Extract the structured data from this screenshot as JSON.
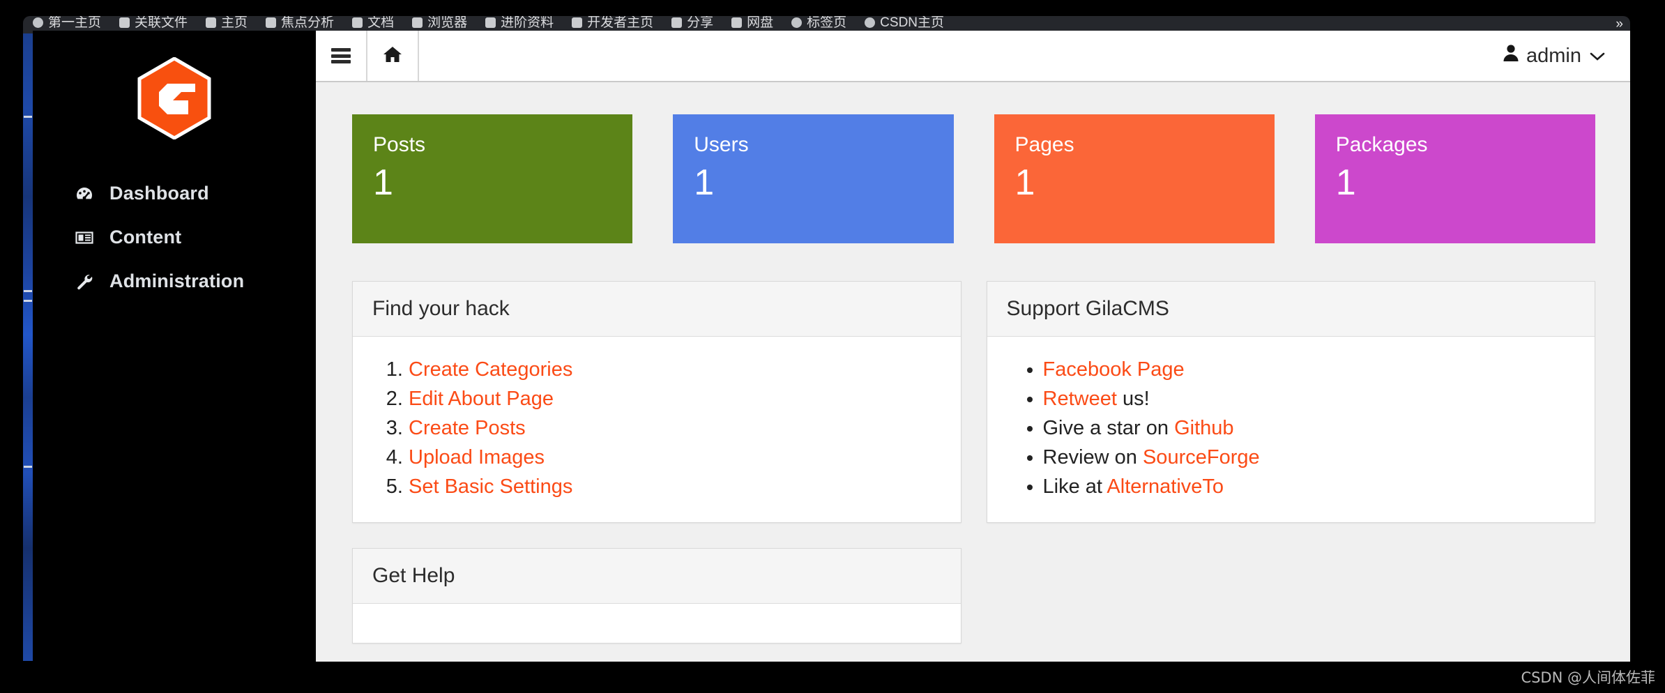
{
  "browser": {
    "bookmarks": [
      {
        "label": "第一主页",
        "icon": "globe-icon"
      },
      {
        "label": "关联文件",
        "icon": "bookmark-icon"
      },
      {
        "label": "主页",
        "icon": "bookmark-icon"
      },
      {
        "label": "焦点分析",
        "icon": "bookmark-icon"
      },
      {
        "label": "文档",
        "icon": "bookmark-icon"
      },
      {
        "label": "浏览器",
        "icon": "bookmark-icon"
      },
      {
        "label": "进阶资料",
        "icon": "bookmark-icon"
      },
      {
        "label": "开发者主页",
        "icon": "bookmark-icon"
      },
      {
        "label": "分享",
        "icon": "bookmark-icon"
      },
      {
        "label": "网盘",
        "icon": "bookmark-icon"
      },
      {
        "label": "标签页",
        "icon": "globe-icon"
      },
      {
        "label": "CSDN主页",
        "icon": "globe-icon"
      }
    ],
    "overflow_label": "»"
  },
  "sidebar": {
    "logo_name": "gilacms-logo",
    "items": [
      {
        "label": "Dashboard",
        "icon": "tachometer-icon"
      },
      {
        "label": "Content",
        "icon": "newspaper-icon"
      },
      {
        "label": "Administration",
        "icon": "wrench-icon"
      }
    ]
  },
  "navbar": {
    "menu_toggle": "hamburger-icon",
    "home_button": "home-icon",
    "user_label": "admin",
    "user_caret": "⌄"
  },
  "stats": [
    {
      "label": "Posts",
      "value": "1",
      "color": "#5c8418"
    },
    {
      "label": "Users",
      "value": "1",
      "color": "#527ee6"
    },
    {
      "label": "Pages",
      "value": "1",
      "color": "#fb6638"
    },
    {
      "label": "Packages",
      "value": "1",
      "color": "#cc48cc"
    }
  ],
  "panels": {
    "find_your_hack": {
      "title": "Find your hack",
      "items": [
        {
          "link": "Create Categories",
          "suffix": ""
        },
        {
          "link": "Edit About Page",
          "suffix": ""
        },
        {
          "link": "Create Posts",
          "suffix": ""
        },
        {
          "link": "Upload Images",
          "suffix": ""
        },
        {
          "link": "Set Basic Settings",
          "suffix": ""
        }
      ]
    },
    "support": {
      "title": "Support GilaCMS",
      "items": [
        {
          "prefix": "",
          "link": "Facebook Page",
          "suffix": ""
        },
        {
          "prefix": "",
          "link": "Retweet",
          "suffix": " us!"
        },
        {
          "prefix": "Give a star on ",
          "link": "Github",
          "suffix": ""
        },
        {
          "prefix": "Review on ",
          "link": "SourceForge",
          "suffix": ""
        },
        {
          "prefix": "Like at ",
          "link": "AlternativeTo",
          "suffix": ""
        }
      ]
    },
    "get_help": {
      "title": "Get Help"
    }
  },
  "watermark": "CSDN @人间体佐菲"
}
